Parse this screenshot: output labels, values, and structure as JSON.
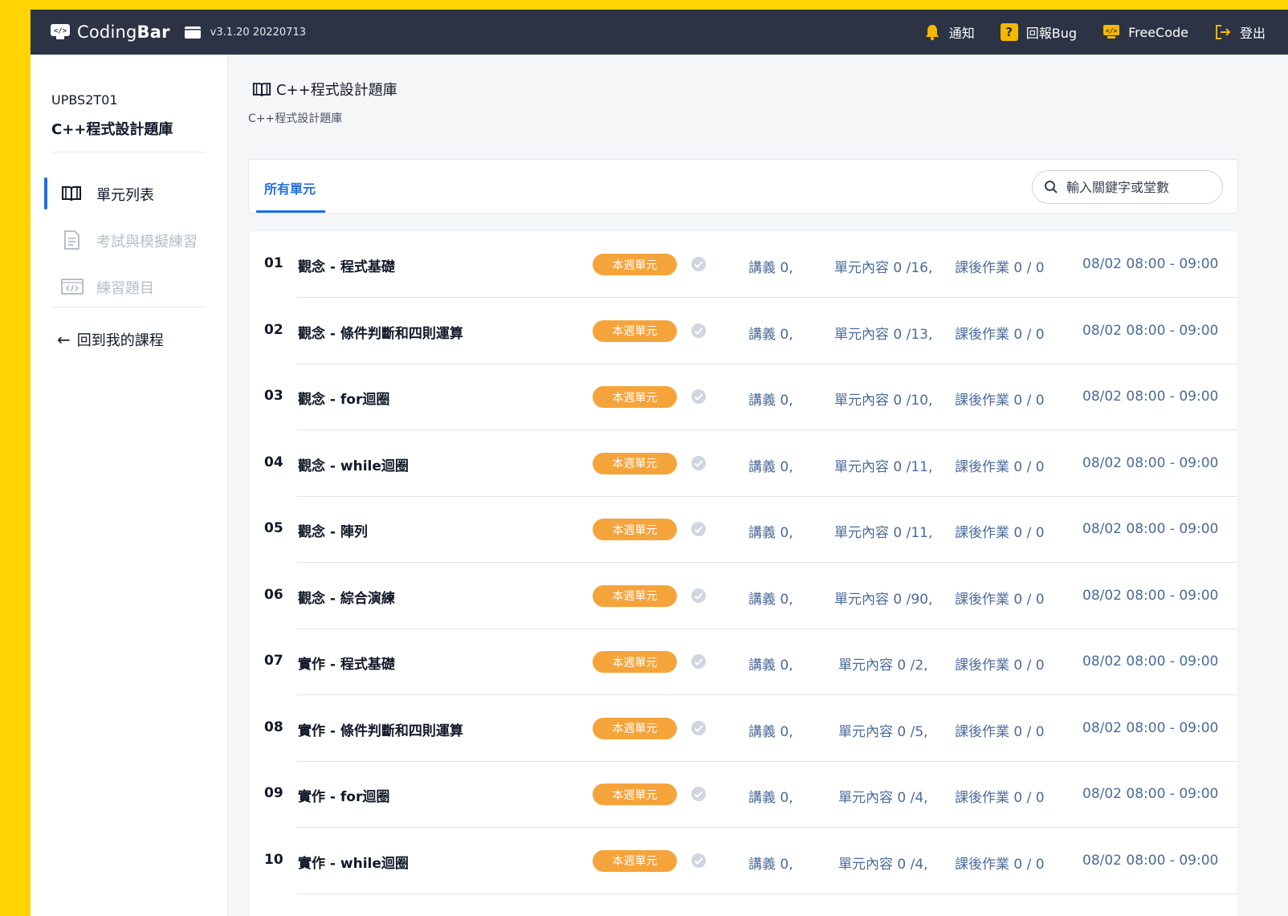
{
  "topbar": {
    "brand_light": "Coding",
    "brand_bold": "Bar",
    "version": "v3.1.20 20220713",
    "actions": {
      "notify": "通知",
      "report_bug": "回報Bug",
      "freecode": "FreeCode",
      "logout": "登出"
    },
    "bug_glyph": "?"
  },
  "sidebar": {
    "course_code": "UPBS2T01",
    "course_name": "C++程式設計題庫",
    "items": [
      {
        "label": "單元列表",
        "icon": "book-icon",
        "state": "active"
      },
      {
        "label": "考試與模擬練習",
        "icon": "document-icon",
        "state": "disabled"
      },
      {
        "label": "練習題目",
        "icon": "code-icon",
        "state": "disabled"
      }
    ],
    "back_label": "回到我的課程"
  },
  "main": {
    "title": "C++程式設計題庫",
    "subtitle": "C++程式設計題庫",
    "tab_all": "所有單元",
    "search_placeholder": "輸入關鍵字或堂數"
  },
  "units": [
    {
      "num": "01",
      "name": "觀念 - 程式基礎",
      "badge": "本週單元",
      "lecture": "講義 0,",
      "content": "單元內容 0 /16,",
      "homework": "課後作業 0 / 0",
      "time": "08/02 08:00 - 09:00"
    },
    {
      "num": "02",
      "name": "觀念 - 條件判斷和四則運算",
      "badge": "本週單元",
      "lecture": "講義 0,",
      "content": "單元內容 0 /13,",
      "homework": "課後作業 0 / 0",
      "time": "08/02 08:00 - 09:00"
    },
    {
      "num": "03",
      "name": "觀念 - for迴圈",
      "badge": "本週單元",
      "lecture": "講義 0,",
      "content": "單元內容 0 /10,",
      "homework": "課後作業 0 / 0",
      "time": "08/02 08:00 - 09:00"
    },
    {
      "num": "04",
      "name": "觀念 - while迴圈",
      "badge": "本週單元",
      "lecture": "講義 0,",
      "content": "單元內容 0 /11,",
      "homework": "課後作業 0 / 0",
      "time": "08/02 08:00 - 09:00"
    },
    {
      "num": "05",
      "name": "觀念 - 陣列",
      "badge": "本週單元",
      "lecture": "講義 0,",
      "content": "單元內容 0 /11,",
      "homework": "課後作業 0 / 0",
      "time": "08/02 08:00 - 09:00"
    },
    {
      "num": "06",
      "name": "觀念 - 綜合演練",
      "badge": "本週單元",
      "lecture": "講義 0,",
      "content": "單元內容 0 /90,",
      "homework": "課後作業 0 / 0",
      "time": "08/02 08:00 - 09:00"
    },
    {
      "num": "07",
      "name": "實作 - 程式基礎",
      "badge": "本週單元",
      "lecture": "講義 0,",
      "content": "單元內容 0 /2,",
      "homework": "課後作業 0 / 0",
      "time": "08/02 08:00 - 09:00"
    },
    {
      "num": "08",
      "name": "實作 - 條件判斷和四則運算",
      "badge": "本週單元",
      "lecture": "講義 0,",
      "content": "單元內容 0 /5,",
      "homework": "課後作業 0 / 0",
      "time": "08/02 08:00 - 09:00"
    },
    {
      "num": "09",
      "name": "實作 - for迴圈",
      "badge": "本週單元",
      "lecture": "講義 0,",
      "content": "單元內容 0 /4,",
      "homework": "課後作業 0 / 0",
      "time": "08/02 08:00 - 09:00"
    },
    {
      "num": "10",
      "name": "實作 - while迴圈",
      "badge": "本週單元",
      "lecture": "講義 0,",
      "content": "單元內容 0 /4,",
      "homework": "課後作業 0 / 0",
      "time": "08/02 08:00 - 09:00"
    }
  ],
  "colors": {
    "frame": "#ffd400",
    "topbar": "#2b3345",
    "accent": "#1f6fe0",
    "badge": "#f5a43b",
    "meta_text": "#4b6b9a",
    "bug_icon": "#f5b800"
  }
}
